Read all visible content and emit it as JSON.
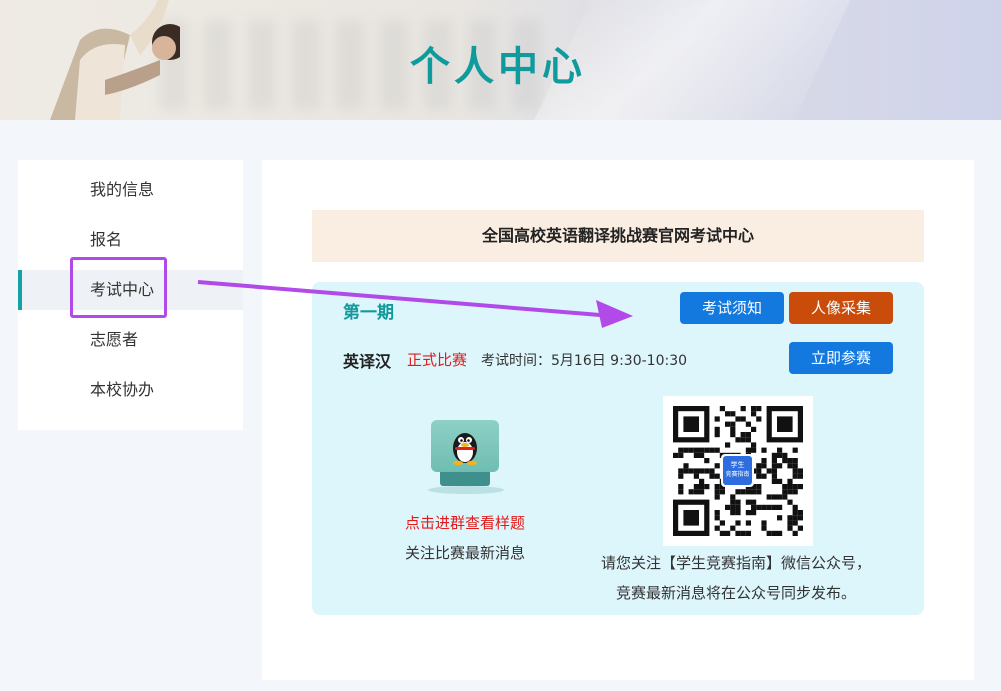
{
  "header": {
    "title": "个人中心"
  },
  "sidebar": {
    "items": [
      {
        "label": "我的信息"
      },
      {
        "label": "报名"
      },
      {
        "label": "考试中心",
        "active": true
      },
      {
        "label": "志愿者"
      },
      {
        "label": "本校协办"
      }
    ]
  },
  "main": {
    "notice_title": "全国高校英语翻译挑战赛官网考试中心",
    "exam": {
      "period": "第一期",
      "name": "英译汉",
      "type": "正式比赛",
      "time": "考试时间：5月16日 9:30-10:30",
      "buttons": {
        "notice": "考试须知",
        "photo": "人像采集",
        "join": "立即参赛"
      }
    },
    "qq": {
      "link": "点击进群查看样题",
      "subtitle": "关注比赛最新消息"
    },
    "wechat": {
      "logo_text_1": "学生",
      "logo_text_2": "竞赛指南",
      "line1": "请您关注【学生竞赛指南】微信公众号，",
      "line2": "竞赛最新消息将在公众号同步发布。"
    }
  },
  "colors": {
    "accent": "#0f9a9c",
    "primary_button": "#1479df",
    "warning_button": "#c94c0a",
    "highlight": "#b14ae8",
    "danger_text": "#e11b1b"
  }
}
